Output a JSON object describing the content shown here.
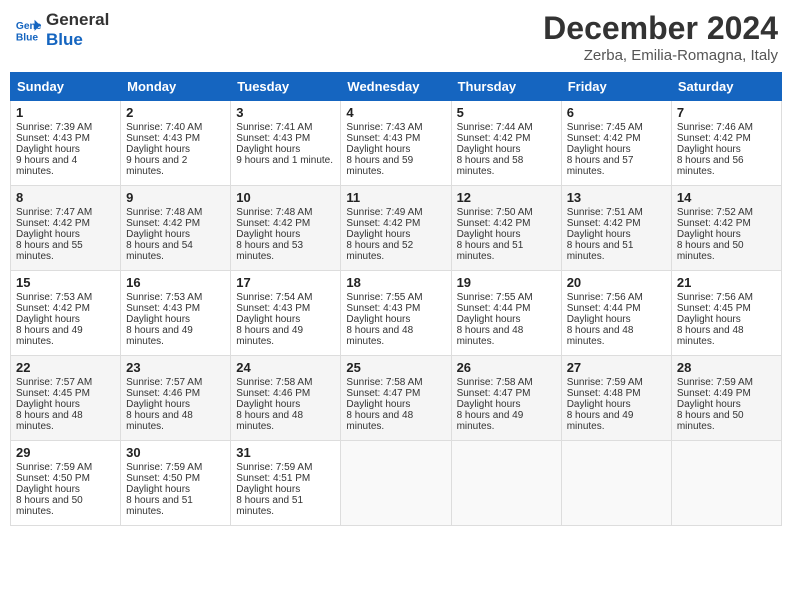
{
  "header": {
    "logo_line1": "General",
    "logo_line2": "Blue",
    "month": "December 2024",
    "location": "Zerba, Emilia-Romagna, Italy"
  },
  "days_of_week": [
    "Sunday",
    "Monday",
    "Tuesday",
    "Wednesday",
    "Thursday",
    "Friday",
    "Saturday"
  ],
  "weeks": [
    [
      {
        "day": 1,
        "sunrise": "7:39 AM",
        "sunset": "4:43 PM",
        "daylight": "9 hours and 4 minutes."
      },
      {
        "day": 2,
        "sunrise": "7:40 AM",
        "sunset": "4:43 PM",
        "daylight": "9 hours and 2 minutes."
      },
      {
        "day": 3,
        "sunrise": "7:41 AM",
        "sunset": "4:43 PM",
        "daylight": "9 hours and 1 minute."
      },
      {
        "day": 4,
        "sunrise": "7:43 AM",
        "sunset": "4:43 PM",
        "daylight": "8 hours and 59 minutes."
      },
      {
        "day": 5,
        "sunrise": "7:44 AM",
        "sunset": "4:42 PM",
        "daylight": "8 hours and 58 minutes."
      },
      {
        "day": 6,
        "sunrise": "7:45 AM",
        "sunset": "4:42 PM",
        "daylight": "8 hours and 57 minutes."
      },
      {
        "day": 7,
        "sunrise": "7:46 AM",
        "sunset": "4:42 PM",
        "daylight": "8 hours and 56 minutes."
      }
    ],
    [
      {
        "day": 8,
        "sunrise": "7:47 AM",
        "sunset": "4:42 PM",
        "daylight": "8 hours and 55 minutes."
      },
      {
        "day": 9,
        "sunrise": "7:48 AM",
        "sunset": "4:42 PM",
        "daylight": "8 hours and 54 minutes."
      },
      {
        "day": 10,
        "sunrise": "7:48 AM",
        "sunset": "4:42 PM",
        "daylight": "8 hours and 53 minutes."
      },
      {
        "day": 11,
        "sunrise": "7:49 AM",
        "sunset": "4:42 PM",
        "daylight": "8 hours and 52 minutes."
      },
      {
        "day": 12,
        "sunrise": "7:50 AM",
        "sunset": "4:42 PM",
        "daylight": "8 hours and 51 minutes."
      },
      {
        "day": 13,
        "sunrise": "7:51 AM",
        "sunset": "4:42 PM",
        "daylight": "8 hours and 51 minutes."
      },
      {
        "day": 14,
        "sunrise": "7:52 AM",
        "sunset": "4:42 PM",
        "daylight": "8 hours and 50 minutes."
      }
    ],
    [
      {
        "day": 15,
        "sunrise": "7:53 AM",
        "sunset": "4:42 PM",
        "daylight": "8 hours and 49 minutes."
      },
      {
        "day": 16,
        "sunrise": "7:53 AM",
        "sunset": "4:43 PM",
        "daylight": "8 hours and 49 minutes."
      },
      {
        "day": 17,
        "sunrise": "7:54 AM",
        "sunset": "4:43 PM",
        "daylight": "8 hours and 49 minutes."
      },
      {
        "day": 18,
        "sunrise": "7:55 AM",
        "sunset": "4:43 PM",
        "daylight": "8 hours and 48 minutes."
      },
      {
        "day": 19,
        "sunrise": "7:55 AM",
        "sunset": "4:44 PM",
        "daylight": "8 hours and 48 minutes."
      },
      {
        "day": 20,
        "sunrise": "7:56 AM",
        "sunset": "4:44 PM",
        "daylight": "8 hours and 48 minutes."
      },
      {
        "day": 21,
        "sunrise": "7:56 AM",
        "sunset": "4:45 PM",
        "daylight": "8 hours and 48 minutes."
      }
    ],
    [
      {
        "day": 22,
        "sunrise": "7:57 AM",
        "sunset": "4:45 PM",
        "daylight": "8 hours and 48 minutes."
      },
      {
        "day": 23,
        "sunrise": "7:57 AM",
        "sunset": "4:46 PM",
        "daylight": "8 hours and 48 minutes."
      },
      {
        "day": 24,
        "sunrise": "7:58 AM",
        "sunset": "4:46 PM",
        "daylight": "8 hours and 48 minutes."
      },
      {
        "day": 25,
        "sunrise": "7:58 AM",
        "sunset": "4:47 PM",
        "daylight": "8 hours and 48 minutes."
      },
      {
        "day": 26,
        "sunrise": "7:58 AM",
        "sunset": "4:47 PM",
        "daylight": "8 hours and 49 minutes."
      },
      {
        "day": 27,
        "sunrise": "7:59 AM",
        "sunset": "4:48 PM",
        "daylight": "8 hours and 49 minutes."
      },
      {
        "day": 28,
        "sunrise": "7:59 AM",
        "sunset": "4:49 PM",
        "daylight": "8 hours and 50 minutes."
      }
    ],
    [
      {
        "day": 29,
        "sunrise": "7:59 AM",
        "sunset": "4:50 PM",
        "daylight": "8 hours and 50 minutes."
      },
      {
        "day": 30,
        "sunrise": "7:59 AM",
        "sunset": "4:50 PM",
        "daylight": "8 hours and 51 minutes."
      },
      {
        "day": 31,
        "sunrise": "7:59 AM",
        "sunset": "4:51 PM",
        "daylight": "8 hours and 51 minutes."
      },
      null,
      null,
      null,
      null
    ]
  ]
}
